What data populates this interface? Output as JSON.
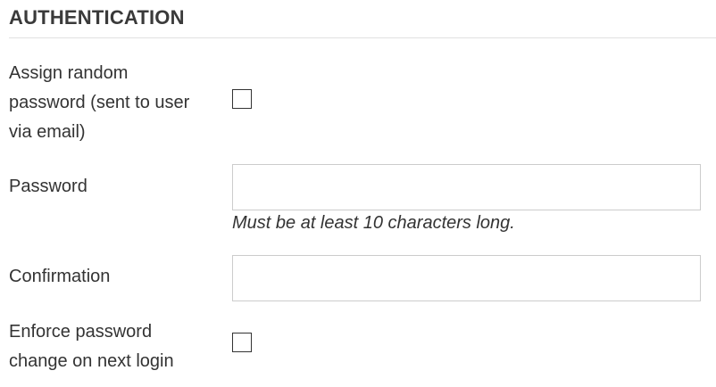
{
  "section": {
    "title": "AUTHENTICATION"
  },
  "fields": {
    "random_password": {
      "label_line1": "Assign random",
      "label_line2": "password (sent to user",
      "label_line3": "via email)",
      "checked": false
    },
    "password": {
      "label": "Password",
      "value": "",
      "help": "Must be at least 10 characters long."
    },
    "confirmation": {
      "label": "Confirmation",
      "value": ""
    },
    "enforce_change": {
      "label_line1": "Enforce password",
      "label_line2": "change on next login",
      "checked": false
    }
  }
}
